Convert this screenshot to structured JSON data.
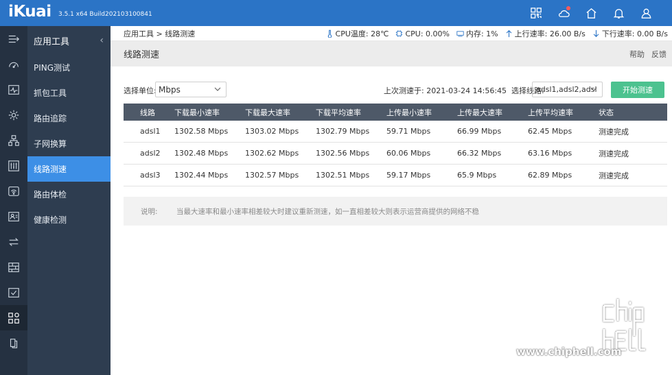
{
  "app": {
    "brand": "iKuai",
    "version": "3.5.1 x64 Build202103100841"
  },
  "topbar_icons": [
    "apps-grid-icon",
    "cloud-icon",
    "home-icon",
    "bell-icon",
    "user-icon"
  ],
  "sidebar": {
    "section_title": "应用工具",
    "collapse_glyph": "‹",
    "items": [
      {
        "label": "PING测试",
        "active": false
      },
      {
        "label": "抓包工具",
        "active": false
      },
      {
        "label": "路由追踪",
        "active": false
      },
      {
        "label": "子网换算",
        "active": false
      },
      {
        "label": "线路测速",
        "active": true
      },
      {
        "label": "路由体检",
        "active": false
      },
      {
        "label": "健康检测",
        "active": false
      }
    ]
  },
  "breadcrumb": "应用工具 > 线路测速",
  "status": {
    "cpu_temp": "CPU温度: 28℃",
    "cpu": "CPU: 0.00%",
    "memory": "内存: 1%",
    "upload": "上行速率: 26.00 B/s",
    "download": "下行速率: 0.00 B/s"
  },
  "page": {
    "title": "线路测速",
    "help": "帮助",
    "feedback": "反馈"
  },
  "controls": {
    "unit_label": "选择单位:",
    "unit_value": "Mbps",
    "last_test": "上次测速于: 2021-03-24 14:56:45",
    "line_label": "选择线路:",
    "line_value": "adsl1,adsl2,adsl",
    "start_button": "开始测速"
  },
  "table": {
    "headers": [
      "线路",
      "下载最小速率",
      "下载最大速率",
      "下载平均速率",
      "上传最小速率",
      "上传最大速率",
      "上传平均速率",
      "状态"
    ],
    "rows": [
      [
        "adsl1",
        "1302.58 Mbps",
        "1303.02 Mbps",
        "1302.79 Mbps",
        "59.71 Mbps",
        "66.99 Mbps",
        "62.45 Mbps",
        "测速完成"
      ],
      [
        "adsl2",
        "1302.48 Mbps",
        "1302.62 Mbps",
        "1302.56 Mbps",
        "60.06 Mbps",
        "66.32 Mbps",
        "63.16 Mbps",
        "测速完成"
      ],
      [
        "adsl3",
        "1302.44 Mbps",
        "1302.57 Mbps",
        "1302.51 Mbps",
        "59.17 Mbps",
        "65.9 Mbps",
        "62.89 Mbps",
        "测速完成"
      ]
    ]
  },
  "note": {
    "label": "说明:",
    "text": "当最大速率和最小速率相差较大时建议重新测速，如一直相差较大则表示运营商提供的网络不稳"
  },
  "watermark": {
    "url": "www.chiphell.com",
    "logo_text": "chip hell"
  },
  "colors": {
    "topbar": "#2b74c6",
    "rail": "#253141",
    "sidebar": "#2e3d50",
    "active": "#3d8fe6",
    "table_header": "#4e5968",
    "start_button": "#4cc28f"
  }
}
